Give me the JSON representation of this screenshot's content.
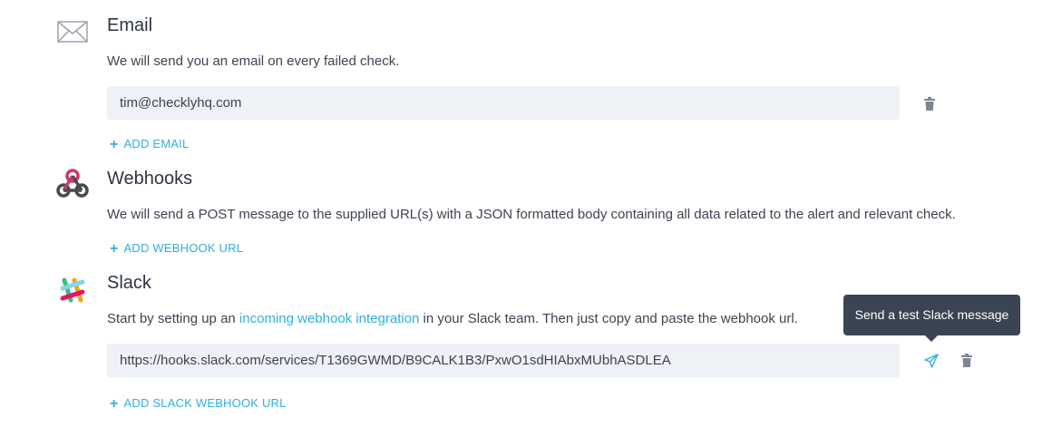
{
  "email": {
    "icon": "envelope-icon",
    "title": "Email",
    "description": "We will send you an email on every failed check.",
    "address": "tim@checklyhq.com",
    "add_label": "ADD EMAIL"
  },
  "webhooks": {
    "icon": "webhook-icon",
    "title": "Webhooks",
    "description": "We will send a POST message to the supplied URL(s) with a JSON formatted body containing all data related to the alert and relevant check.",
    "add_label": "ADD WEBHOOK URL"
  },
  "slack": {
    "icon": "slack-icon",
    "title": "Slack",
    "description_prefix": "Start by setting up an ",
    "description_link": "incoming webhook integration",
    "description_suffix": " in your Slack team. Then just copy and paste the webhook url.",
    "webhook_url": "https://hooks.slack.com/services/T1369GWMD/B9CALK1B3/PxwO1sdHIAbxMUbhASDLEA",
    "add_label": "ADD SLACK WEBHOOK URL",
    "tooltip": "Send a test Slack message"
  },
  "colors": {
    "accent": "#2fb0de",
    "field_bg": "#eef1f5",
    "tooltip_bg": "#3a4452"
  }
}
